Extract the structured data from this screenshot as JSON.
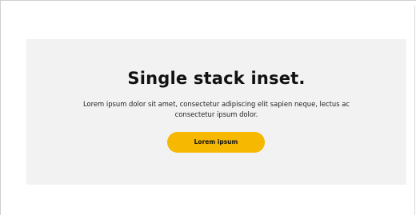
{
  "section": {
    "heading": "Single stack inset.",
    "description": "Lorem ipsum dolor sit amet, consectetur adipiscing elit sapien neque, lectus ac consectetur ipsum dolor.",
    "button_label": "Lorem ipsum"
  },
  "colors": {
    "background": "#ffffff",
    "panel": "#f2f2f2",
    "accent": "#f6b800",
    "text": "#111111"
  }
}
